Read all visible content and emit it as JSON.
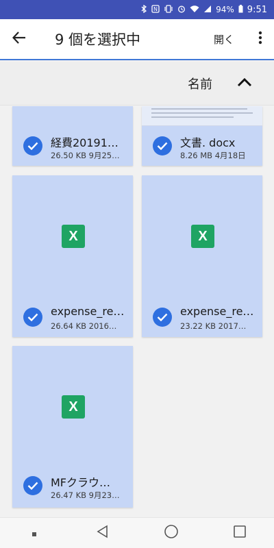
{
  "status_bar": {
    "icons": [
      "bluetooth-icon",
      "nfc-icon",
      "vibrate-icon",
      "alarm-icon",
      "wifi-icon",
      "signal-icon"
    ],
    "battery": "94%",
    "time": "9:51"
  },
  "toolbar": {
    "title": "9 個を選択中",
    "open_label": "開く"
  },
  "sort_bar": {
    "label": "名前",
    "direction_icon": "chevron-up-icon"
  },
  "colors": {
    "status_bar": "#3f51b5",
    "accent": "#2e6fe0",
    "tile_selected": "#c6d6f6",
    "excel_green": "#1fa463"
  },
  "files": [
    {
      "name": "経費20191…",
      "meta": "26.50 KB 9月25…",
      "type": "excel",
      "selected": true
    },
    {
      "name": "文書. docx",
      "meta": "8.26 MB 4月18日",
      "type": "doc",
      "selected": true
    },
    {
      "name": "expense_re…",
      "meta": "26.64 KB 2016…",
      "type": "excel",
      "icon_letter": "X",
      "selected": true
    },
    {
      "name": "expense_re…",
      "meta": "23.22 KB 2017…",
      "type": "excel",
      "icon_letter": "X",
      "selected": true
    },
    {
      "name": "MFクラウ…",
      "meta": "26.47 KB 9月23…",
      "type": "excel",
      "icon_letter": "X",
      "selected": true
    }
  ],
  "nav_bar": {
    "buttons": [
      "recents-dot-icon",
      "back-triangle-icon",
      "home-circle-icon",
      "overview-square-icon"
    ]
  }
}
